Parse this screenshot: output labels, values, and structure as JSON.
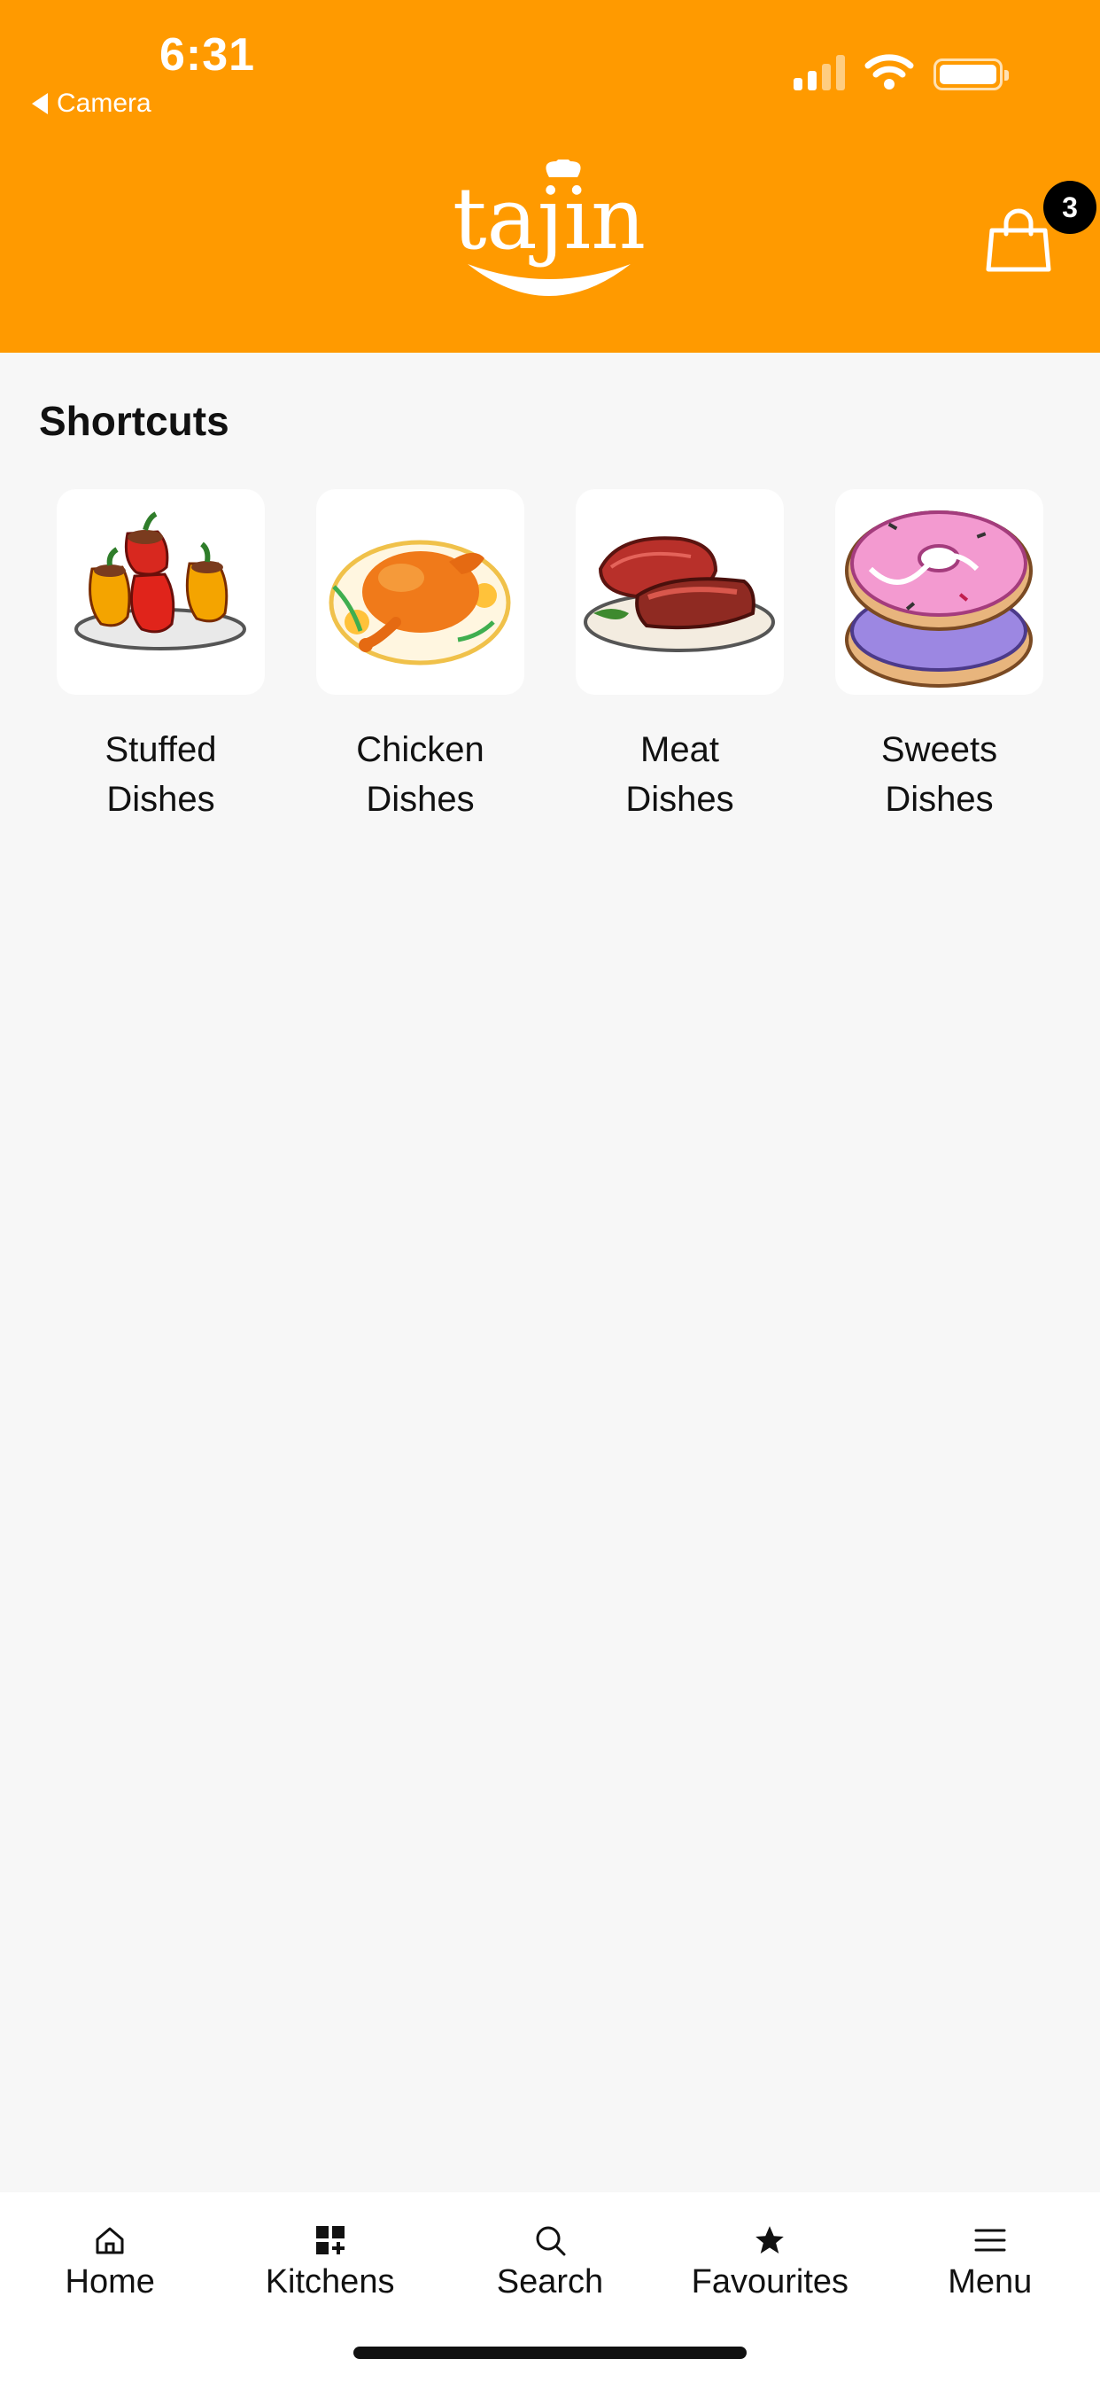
{
  "status_bar": {
    "time": "6:31",
    "back_label": "Camera"
  },
  "header": {
    "logo_text": "tajin",
    "cart_count": "3",
    "brand_color": "#ff9a00"
  },
  "shortcuts": {
    "title": "Shortcuts",
    "items": [
      {
        "label": "Stuffed\nDishes",
        "icon": "stuffed-peppers-image"
      },
      {
        "label": "Chicken\nDishes",
        "icon": "roast-chicken-image"
      },
      {
        "label": "Meat\nDishes",
        "icon": "steak-image"
      },
      {
        "label": "Sweets\nDishes",
        "icon": "donuts-image"
      }
    ]
  },
  "tabbar": {
    "items": [
      {
        "label": "Home",
        "icon": "home-icon"
      },
      {
        "label": "Kitchens",
        "icon": "grid-plus-icon"
      },
      {
        "label": "Search",
        "icon": "search-icon"
      },
      {
        "label": "Favourites",
        "icon": "star-icon"
      },
      {
        "label": "Menu",
        "icon": "menu-icon"
      }
    ]
  }
}
